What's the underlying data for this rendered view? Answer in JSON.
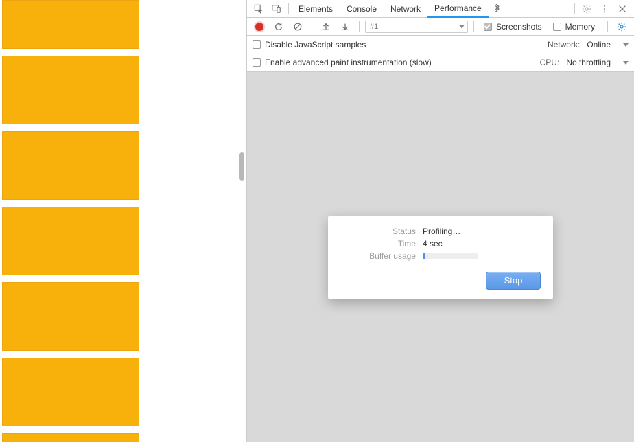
{
  "tabs": {
    "elements": "Elements",
    "console": "Console",
    "network": "Network",
    "performance": "Performance",
    "active": "performance"
  },
  "toolbar": {
    "recording_select": "#1",
    "screenshots_label": "Screenshots",
    "memory_label": "Memory",
    "screenshots_checked": true,
    "memory_checked": false
  },
  "settings": {
    "disable_js_label": "Disable JavaScript samples",
    "advanced_paint_label": "Enable advanced paint instrumentation (slow)",
    "network_label": "Network:",
    "network_value": "Online",
    "cpu_label": "CPU:",
    "cpu_value": "No throttling"
  },
  "modal": {
    "status_label": "Status",
    "status_value": "Profiling…",
    "time_label": "Time",
    "time_value": "4 sec",
    "buffer_label": "Buffer usage",
    "buffer_pct": 5,
    "stop_label": "Stop"
  },
  "page": {
    "card_count": 7
  }
}
